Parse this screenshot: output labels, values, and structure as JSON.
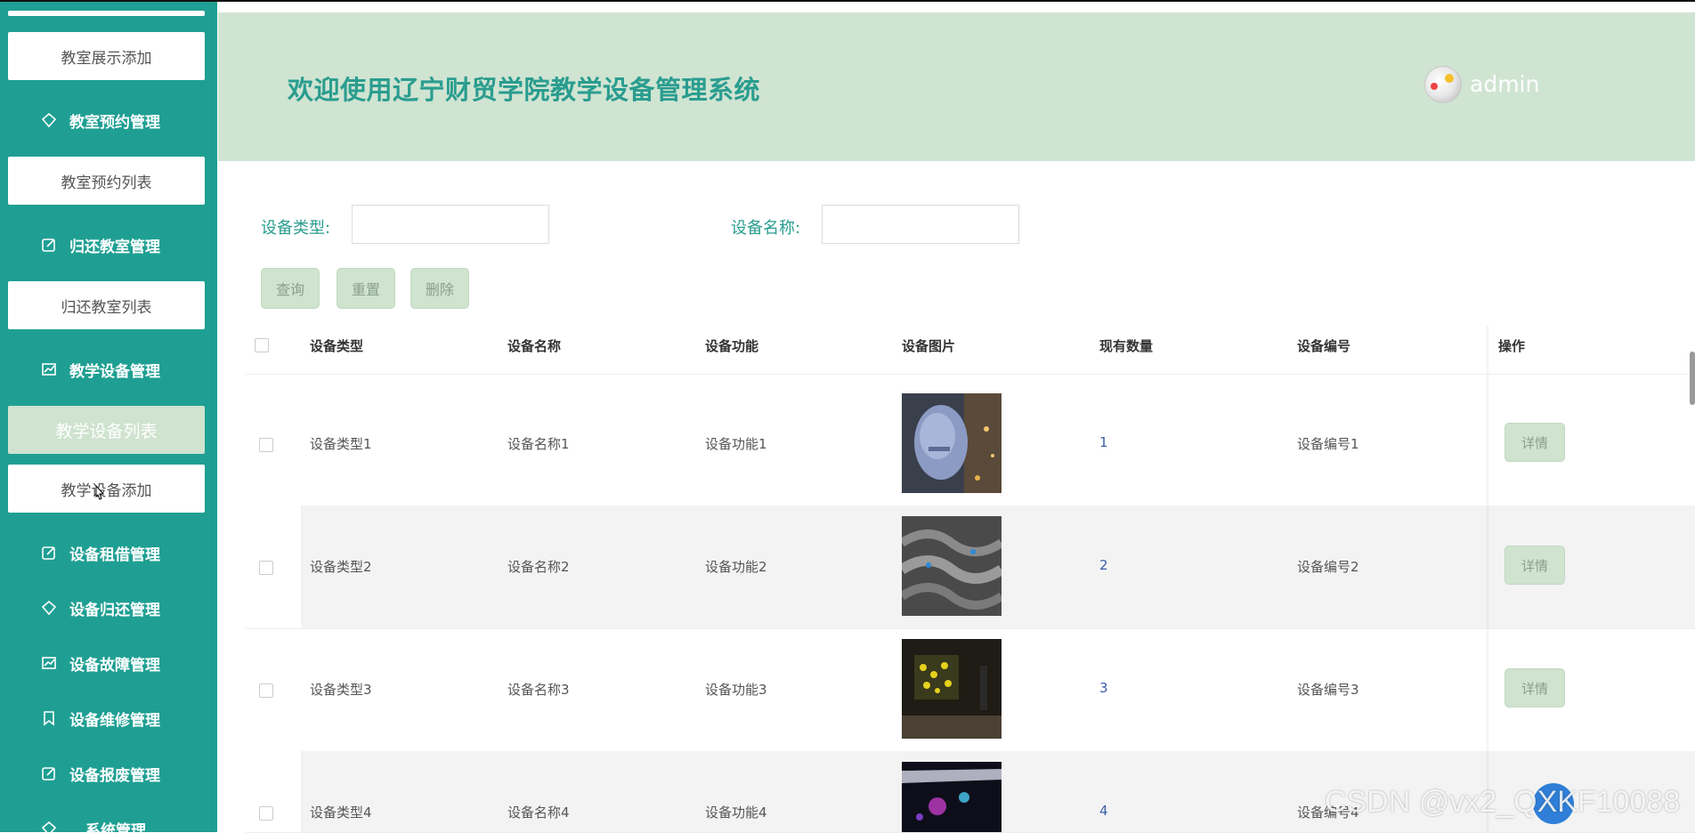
{
  "header": {
    "title": "欢迎使用辽宁财贸学院教学设备管理系统",
    "user": "admin"
  },
  "sidebar": {
    "sub_classroom_add": "教室展示添加",
    "head_reservation": "教室预约管理",
    "sub_reservation_list": "教室预约列表",
    "head_return_room": "归还教室管理",
    "sub_return_room_list": "归还教室列表",
    "head_equipment": "教学设备管理",
    "sub_equipment_list": "教学设备列表",
    "sub_equipment_add": "教学设备添加",
    "head_borrow": "设备租借管理",
    "head_return_equipment": "设备归还管理",
    "head_fault": "设备故障管理",
    "head_repair": "设备维修管理",
    "head_scrap": "设备报废管理",
    "head_system": "系统管理"
  },
  "search": {
    "type_label": "设备类型:",
    "name_label": "设备名称:",
    "type_value": "",
    "name_value": "",
    "query_button": "查询",
    "reset_button": "重置",
    "delete_button": "删除"
  },
  "table": {
    "columns": [
      "设备类型",
      "设备名称",
      "设备功能",
      "设备图片",
      "现有数量",
      "设备编号",
      "操作"
    ],
    "rows": [
      {
        "type": "设备类型1",
        "name": "设备名称1",
        "function": "设备功能1",
        "quantity": "1",
        "code": "设备编号1",
        "action": "详情"
      },
      {
        "type": "设备类型2",
        "name": "设备名称2",
        "function": "设备功能2",
        "quantity": "2",
        "code": "设备编号2",
        "action": "详情"
      },
      {
        "type": "设备类型3",
        "name": "设备名称3",
        "function": "设备功能3",
        "quantity": "3",
        "code": "设备编号3",
        "action": "详情"
      },
      {
        "type": "设备类型4",
        "name": "设备名称4",
        "function": "设备功能4",
        "quantity": "4",
        "code": "设备编号4",
        "action": "详情"
      }
    ]
  },
  "watermark": "CSDN @vx2_QXKF10088",
  "colors": {
    "sidebar": "#1f9f93",
    "header_bg": "#d0e4d2",
    "accent_text": "#2a9d8f",
    "button_bg": "#cfe3cf"
  },
  "icons": {
    "sidebar_heads": [
      "diamond-icon",
      "edit-icon",
      "chart-icon",
      "edit-icon",
      "diamond-icon",
      "chart-icon",
      "bookmark-icon",
      "edit-icon",
      "diamond-icon"
    ]
  }
}
